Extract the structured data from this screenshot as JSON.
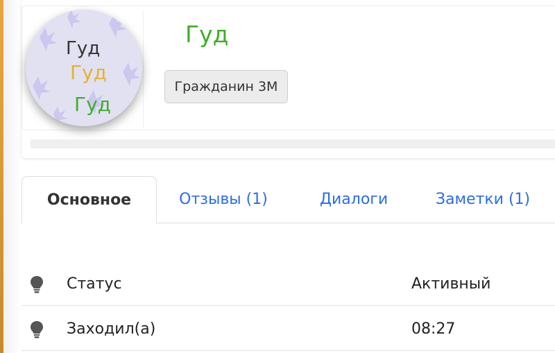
{
  "profile": {
    "avatar_text": [
      "Гуд",
      "Гуд",
      "Гуд"
    ],
    "name": "Гуд",
    "rank": "Гражданин 3М"
  },
  "tabs": [
    {
      "label": "Основное",
      "active": true
    },
    {
      "label": "Отзывы (1)",
      "active": false
    },
    {
      "label": "Диалоги",
      "active": false
    },
    {
      "label": "Заметки (1)",
      "active": false
    }
  ],
  "info": [
    {
      "icon": "lightbulb-icon",
      "label": "Статус",
      "value": "Активный"
    },
    {
      "icon": "lightbulb-icon",
      "label": "Заходил(а)",
      "value": "08:27"
    }
  ],
  "colors": {
    "name": "#3fae2a",
    "link": "#2b6de6",
    "avatar_text_1": "#333333",
    "avatar_text_2": "#e5b22e",
    "avatar_text_3": "#3fae2a"
  }
}
